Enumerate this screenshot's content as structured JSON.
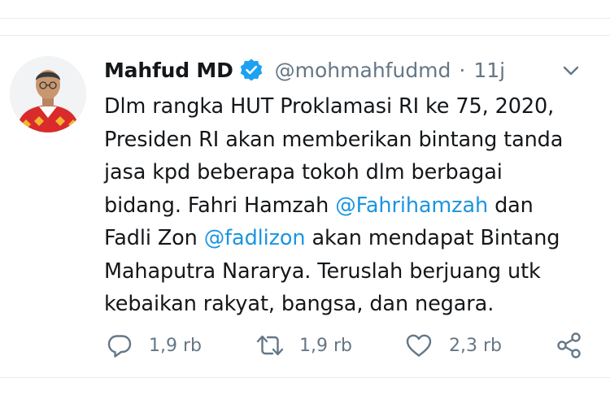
{
  "tweet": {
    "author_name": "Mahfud MD",
    "handle": "@mohmahfudmd",
    "separator": "·",
    "time": "11j",
    "text_lines": [
      [
        {
          "t": "Dlm rangka HUT Proklamasi RI ke 75, 2020,"
        }
      ],
      [
        {
          "t": "Presiden RI akan memberikan bintang tanda"
        }
      ],
      [
        {
          "t": "jasa kpd beberapa tokoh dlm berbagai"
        }
      ],
      [
        {
          "t": "bidang. Fahri Hamzah "
        },
        {
          "t": "@Fahrihamzah",
          "mention": true
        },
        {
          "t": " dan"
        }
      ],
      [
        {
          "t": "Fadli Zon "
        },
        {
          "t": "@fadlizon",
          "mention": true
        },
        {
          "t": " akan mendapat Bintang"
        }
      ],
      [
        {
          "t": "Mahaputra Nararya. Teruslah berjuang utk"
        }
      ],
      [
        {
          "t": "kebaikan rakyat, bangsa, dan negara."
        }
      ]
    ],
    "actions": {
      "reply_count": "1,9 rb",
      "retweet_count": "1,9 rb",
      "like_count": "2,3 rb"
    }
  },
  "colors": {
    "text": "#14171a",
    "secondary": "#657786",
    "link": "#1b95e0",
    "verified": "#1da1f2",
    "divider": "#e6ecf0"
  },
  "icons": {
    "verified": "verified-badge-icon",
    "caret": "chevron-down-icon",
    "reply": "reply-icon",
    "retweet": "retweet-icon",
    "like": "heart-icon",
    "share": "share-icon"
  }
}
